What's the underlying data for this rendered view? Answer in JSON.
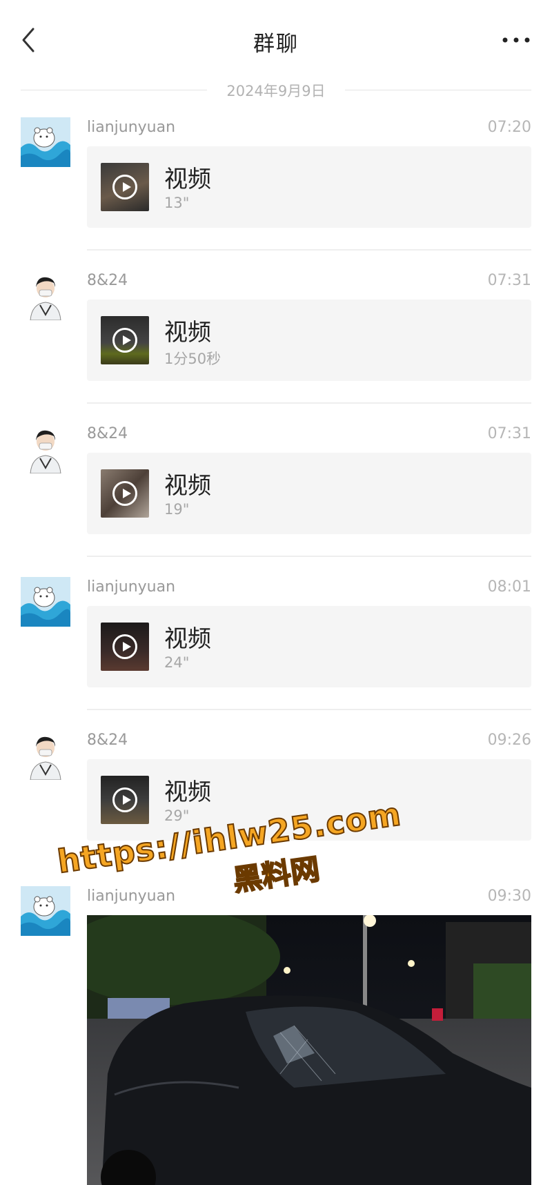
{
  "header": {
    "title": "群聊",
    "back_icon": "chevron-left-icon",
    "more_icon": "more-horizontal-icon"
  },
  "date_divider": "2024年9月9日",
  "messages": [
    {
      "sender": "lianjunyuan",
      "time": "07:20",
      "type": "video",
      "label": "视频",
      "duration": "13\"",
      "avatar": "polar-bear-wave-avatar"
    },
    {
      "sender": "8&24",
      "time": "07:31",
      "type": "video",
      "label": "视频",
      "duration": "1分50秒",
      "avatar": "masked-person-avatar"
    },
    {
      "sender": "8&24",
      "time": "07:31",
      "type": "video",
      "label": "视频",
      "duration": "19\"",
      "avatar": "masked-person-avatar"
    },
    {
      "sender": "lianjunyuan",
      "time": "08:01",
      "type": "video",
      "label": "视频",
      "duration": "24\"",
      "avatar": "polar-bear-wave-avatar"
    },
    {
      "sender": "8&24",
      "time": "09:26",
      "type": "video",
      "label": "视频",
      "duration": "29\"",
      "avatar": "masked-person-avatar"
    },
    {
      "sender": "lianjunyuan",
      "time": "09:30",
      "type": "image",
      "avatar": "polar-bear-wave-avatar"
    }
  ],
  "watermark": {
    "url": "https://ihlw25.com",
    "site_name": "黑料网"
  },
  "colors": {
    "card_bg": "#f5f5f5",
    "meta_text": "#999999",
    "watermark": "#f5a623"
  }
}
